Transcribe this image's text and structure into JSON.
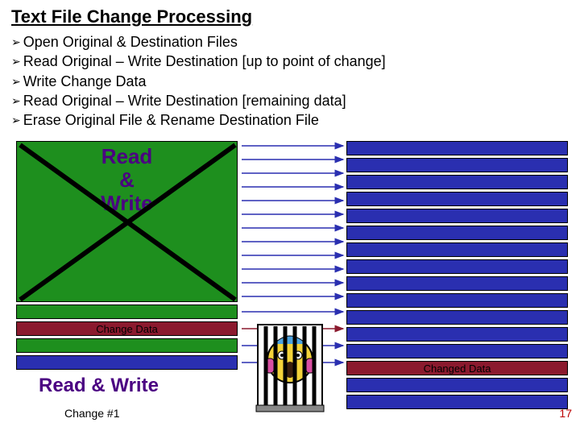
{
  "title": "Text File Change Processing",
  "bullets": [
    "Open Original & Destination Files",
    "Read Original – Write Destination [up to point of change]",
    "Write Change Data",
    "Read Original – Write Destination [remaining data]",
    "Erase Original File & Rename Destination File"
  ],
  "labels": {
    "rw_top1": "Read",
    "rw_top2": "&",
    "rw_top3": "Write",
    "change_left": "Change Data",
    "changed_right": "Changed Data",
    "rw_bottom": "Read & Write",
    "caption": "Change #1",
    "pgnum": "17"
  },
  "colors": {
    "green": "#1E8F1E",
    "maroon": "#8B1A2E",
    "blue": "#2A2FB0",
    "purple": "#4B0082",
    "red": "#b00000"
  },
  "chart_data": {
    "type": "diagram",
    "title": "Text File Change Processing",
    "arrows_count": 17,
    "left_block": {
      "color": "green",
      "overlay": "Read & Write",
      "crossed_out": true
    },
    "left_stripes": [
      {
        "color": "green"
      },
      {
        "color": "maroon",
        "label": "Change Data"
      },
      {
        "color": "green"
      },
      {
        "color": "blue"
      }
    ],
    "right_stripes_top": {
      "count": 12,
      "color": "blue"
    },
    "right_stripes_bottom": [
      {
        "color": "blue"
      },
      {
        "color": "maroon",
        "label": "Changed Data"
      },
      {
        "color": "blue"
      },
      {
        "color": "blue"
      }
    ],
    "bottom_label": "Read & Write",
    "caption": "Change #1",
    "page": 17
  }
}
